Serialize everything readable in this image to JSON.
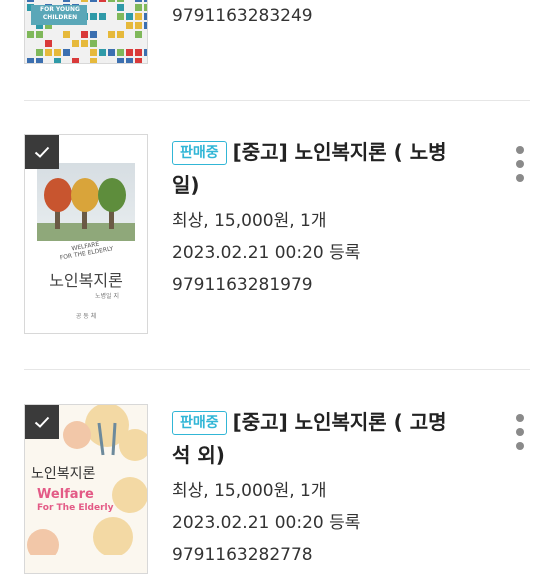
{
  "listings": [
    {
      "isbn": "9791163283249",
      "cover_text": [
        "FOR YOUNG",
        "CHILDREN"
      ]
    },
    {
      "checked": true,
      "badge": "판매중",
      "title": "[중고] 노인복지론 ( 노병일)",
      "price_line": "최상, 15,000원, 1개",
      "date_line": "2023.02.21 00:20 등록",
      "isbn": "9791163281979",
      "cover": {
        "title_en_1": "WELFARE",
        "title_en_2": "FOR THE ELDERLY",
        "title_ko": "노인복지론",
        "author": "노병일 지",
        "publisher": "공 동 체"
      }
    },
    {
      "checked": true,
      "badge": "판매중",
      "title": "[중고] 노인복지론 ( 고명석 외)",
      "price_line": "최상, 15,000원, 1개",
      "date_line": "2023.02.21 00:20 등록",
      "isbn": "9791163282778",
      "cover": {
        "title_ko": "노인복지론",
        "title_en_1": "Welfare",
        "title_en_2": "For The Elderly"
      }
    }
  ],
  "icons": {
    "check": "checkmark-icon",
    "more": "more-vertical-icon"
  },
  "colors": {
    "badge": "#31b6d6",
    "check_bg": "#3a3a3a",
    "kebab": "#8a8a8a"
  }
}
